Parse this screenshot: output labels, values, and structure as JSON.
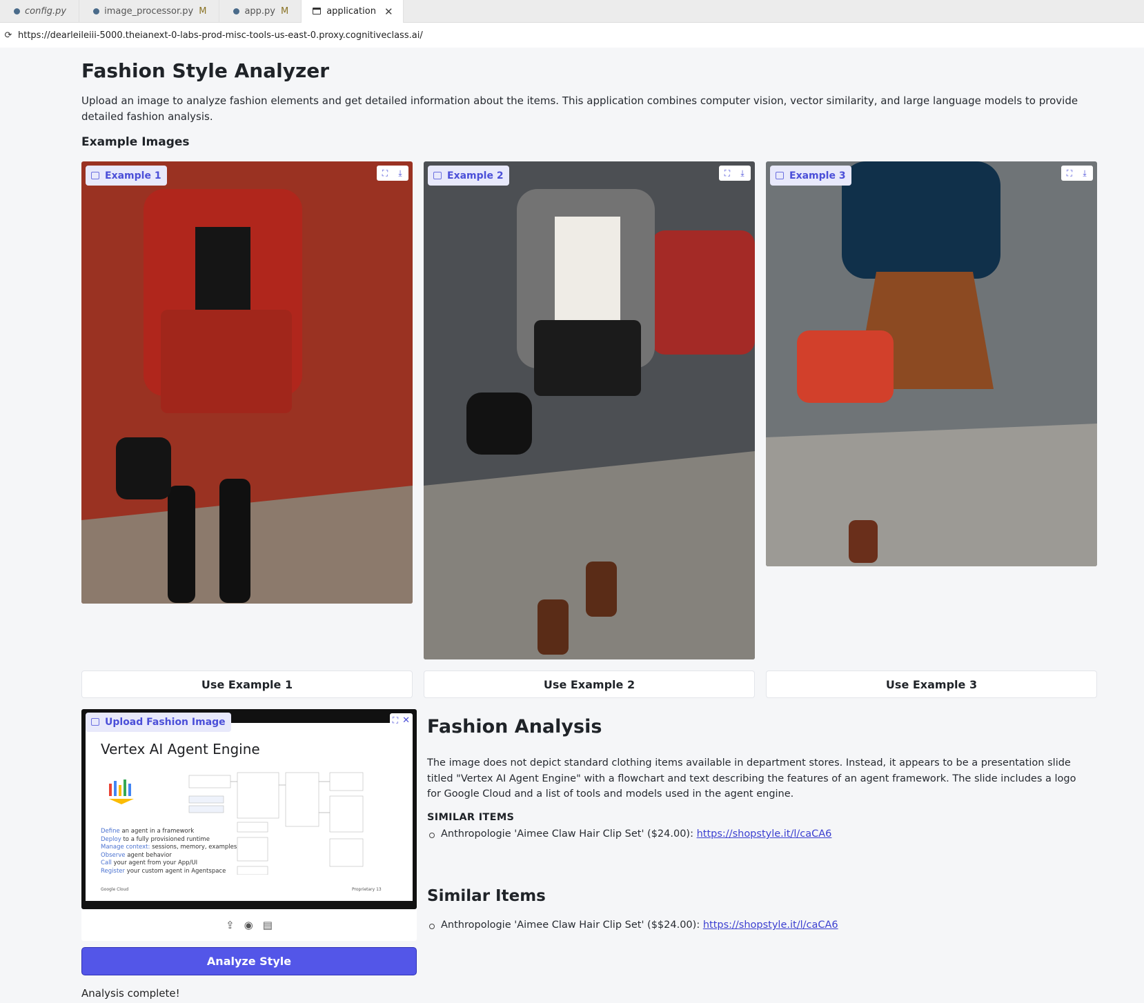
{
  "editor": {
    "tabs": [
      {
        "label": "config.py",
        "modified": ""
      },
      {
        "label": "image_processor.py",
        "modified": "M"
      },
      {
        "label": "app.py",
        "modified": "M"
      },
      {
        "label": "application",
        "modified": ""
      }
    ]
  },
  "browser": {
    "url": "https://dearleileiii-5000.theianext-0-labs-prod-misc-tools-us-east-0.proxy.cognitiveclass.ai/"
  },
  "app": {
    "title": "Fashion Style Analyzer",
    "description": "Upload an image to analyze fashion elements and get detailed information about the items. This application combines computer vision, vector similarity, and large language models to provide detailed fashion analysis.",
    "examples_heading": "Example Images",
    "examples": [
      {
        "badge": "Example 1",
        "button": "Use Example 1",
        "colors": {
          "wall": "#9a3222",
          "outfit": "#b0261c",
          "ground": "#8c7a6c"
        }
      },
      {
        "badge": "Example 2",
        "button": "Use Example 2",
        "colors": {
          "wall": "#4c4f53",
          "outfit": "#efece6",
          "ground": "#85827c"
        }
      },
      {
        "badge": "Example 3",
        "button": "Use Example 3",
        "colors": {
          "wall": "#6f7477",
          "outfit": "#8c4a22",
          "ground": "#9c9a95"
        }
      }
    ],
    "upload": {
      "badge": "Upload Fashion Image",
      "slide_title": "Vertex AI Agent Engine",
      "slide_lines": [
        {
          "verb": "Define",
          "rest": " an agent in a framework"
        },
        {
          "verb": "Deploy",
          "rest": " to a fully provisioned runtime"
        },
        {
          "verb": "Manage context:",
          "rest": " sessions, memory, examples"
        },
        {
          "verb": "Observe",
          "rest": " agent behavior"
        },
        {
          "verb": "Call",
          "rest": " your agent from your App/UI"
        },
        {
          "verb": "Register",
          "rest": " your custom agent in Agentspace"
        }
      ],
      "slide_footer_left": "Google Cloud",
      "slide_footer_right": "Proprietary    13"
    },
    "analyze_button": "Analyze Style",
    "status": "Analysis complete!",
    "analysis": {
      "heading": "Fashion Analysis",
      "paragraph": "The image does not depict standard clothing items available in department stores. Instead, it appears to be a presentation slide titled \"Vertex AI Agent Engine\" with a flowchart and text describing the features of an agent framework. The slide includes a logo for Google Cloud and a list of tools and models used in the agent engine.",
      "similar_heading_caps": "SIMILAR ITEMS",
      "similar_item_1_text": "Anthropologie 'Aimee Claw Hair Clip Set' ($24.00): ",
      "similar_item_1_link": "https://shopstyle.it/l/caCA6",
      "similar_heading": "Similar Items",
      "similar_item_2_text": "Anthropologie 'Aimee Claw Hair Clip Set' ($$24.00): ",
      "similar_item_2_link": "https://shopstyle.it/l/caCA6"
    }
  }
}
